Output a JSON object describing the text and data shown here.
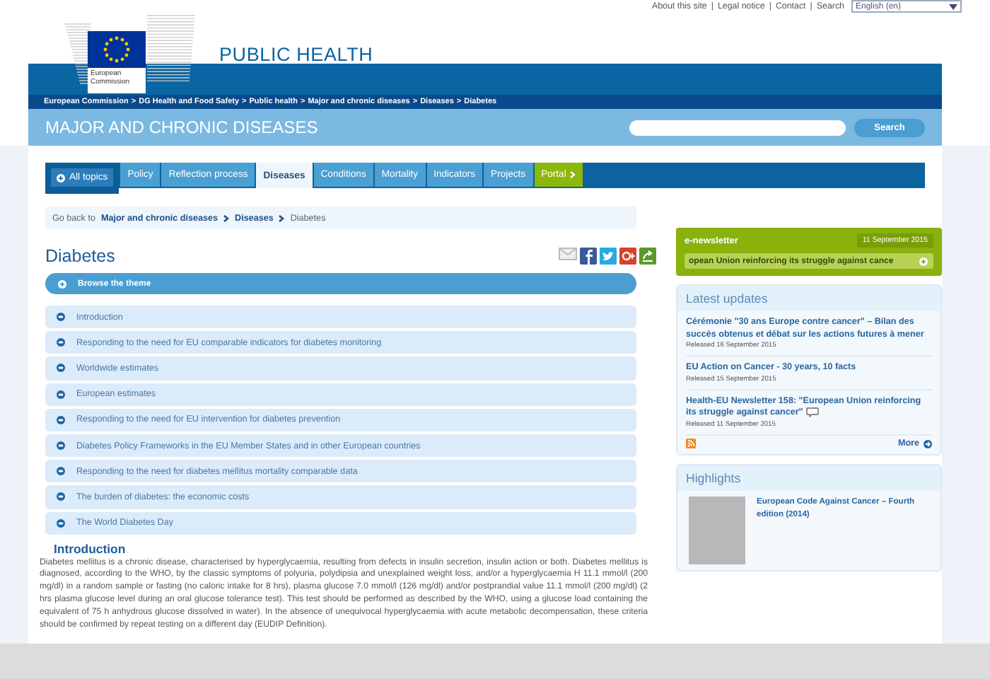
{
  "top_links": {
    "items": [
      "About this site",
      "Legal notice",
      "Contact",
      "Search"
    ],
    "separator": "|"
  },
  "language_select": {
    "value": "English (en)"
  },
  "logo": {
    "caption": "European Commission"
  },
  "site_title": "PUBLIC HEALTH",
  "breadcrumb": {
    "separator": ">",
    "items": [
      "European Commission",
      "DG Health and Food Safety",
      "Public health",
      "Major and chronic diseases",
      "Diseases",
      "Diabetes"
    ]
  },
  "section_title": "MAJOR AND CHRONIC DISEASES",
  "search": {
    "button": "Search"
  },
  "tabs": [
    {
      "label": "All topics",
      "kind": "menu",
      "selected": false
    },
    {
      "label": "Policy",
      "kind": "tab",
      "selected": false
    },
    {
      "label": "Reflection process",
      "kind": "tab",
      "selected": false
    },
    {
      "label": "Diseases",
      "kind": "tab",
      "selected": true
    },
    {
      "label": "Conditions",
      "kind": "tab",
      "selected": false
    },
    {
      "label": "Mortality",
      "kind": "tab",
      "selected": false
    },
    {
      "label": "Indicators",
      "kind": "tab",
      "selected": false
    },
    {
      "label": "Projects",
      "kind": "tab",
      "selected": false
    },
    {
      "label": "Portal",
      "kind": "portal",
      "selected": false
    }
  ],
  "go_back": {
    "label": "Go back to",
    "links": [
      "Major and chronic diseases",
      "Diseases"
    ],
    "current": "Diabetes"
  },
  "page_title": "Diabetes",
  "browse_theme": "Browse the theme",
  "toc": [
    "Introduction",
    "Responding to the need for EU comparable indicators for diabetes monitoring",
    "Worldwide estimates",
    "European estimates",
    "Responding to the need for EU intervention for diabetes prevention",
    "Diabetes Policy Frameworks in the EU Member States and in other European countries",
    "Responding to the need for diabetes mellitus mortality comparable data",
    "The burden of diabetes: the economic costs",
    "The World Diabetes Day"
  ],
  "intro": {
    "heading": "Introduction",
    "text": "Diabetes mellitus is a chronic disease, characterised by hyperglycaemia, resulting from defects in insulin secretion, insulin action or both. Diabetes mellitus is diagnosed, according to the WHO, by the classic symptoms of polyuria, polydipsia and unexplained weight loss, and/or a hyperglycaemia H 11.1 mmol/l (200 mg/dl) in a random sample or fasting (no caloric intake for 8 hrs), plasma glucose 7.0 mmol/l (126 mg/dl) and/or postprandial value 11.1 mmol/l (200 mg/dl) (2 hrs plasma glucose level during an oral glucose tolerance test). This test should be performed as described by the WHO, using a glucose load containing the equivalent of 75 h anhydrous glucose dissolved in water). In the absence of unequivocal hyperglycaemia with acute metabolic decompensation, these criteria should be confirmed by repeat testing on a different day (EUDIP Definition)."
  },
  "newsletter": {
    "title": "e-newsletter",
    "date": "11 September 2015",
    "ticker": "opean Union reinforcing its struggle against cance"
  },
  "latest_updates": {
    "title": "Latest updates",
    "items": [
      {
        "title": "Cérémonie \"30 ans Europe contre cancer\" – Bilan des succès obtenus et débat sur les actions futures à mener",
        "released": "Released 16 September 2015",
        "comment": false
      },
      {
        "title": "EU Action on Cancer - 30 years, 10 facts",
        "released": "Released 15 September 2015",
        "comment": false
      },
      {
        "title": "Health-EU Newsletter 158: \"European Union reinforcing its struggle against cancer\"",
        "released": "Released 11 September 2015",
        "comment": true
      }
    ],
    "more": "More"
  },
  "highlights": {
    "title": "Highlights",
    "items": [
      {
        "title": "European Code Against Cancer – Fourth edition (2014)"
      }
    ]
  }
}
